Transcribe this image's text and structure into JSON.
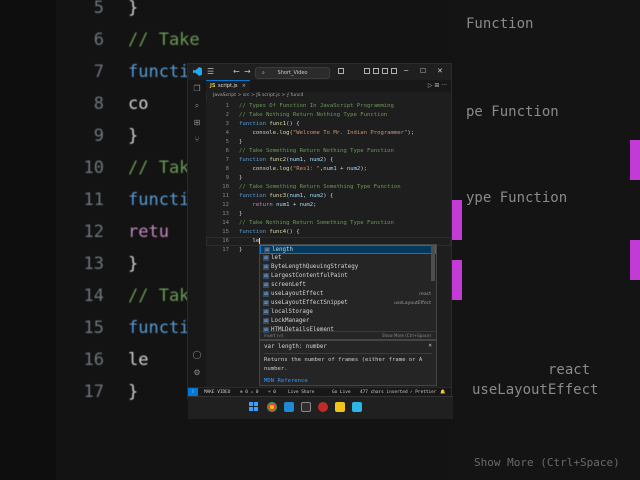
{
  "background": {
    "lines": [
      {
        "num": "5",
        "code": "}"
      },
      {
        "num": "6",
        "code": "// Take"
      },
      {
        "num": "7",
        "code": "functio"
      },
      {
        "num": "8",
        "code": "    co"
      },
      {
        "num": "9",
        "code": "}"
      },
      {
        "num": "10",
        "code": "// Take"
      },
      {
        "num": "11",
        "code": "functio"
      },
      {
        "num": "12",
        "code": "    retu"
      },
      {
        "num": "13",
        "code": "}"
      },
      {
        "num": "14",
        "code": "// Take"
      },
      {
        "num": "15",
        "code": "functio"
      },
      {
        "num": "16",
        "code": "    le"
      },
      {
        "num": "17",
        "code": "}"
      }
    ],
    "right_texts": [
      "Function",
      "pe Function",
      "ype Function",
      "react",
      "useLayoutEffect",
      "Show More (Ctrl+Space)"
    ]
  },
  "titlebar": {
    "search_text": "Short_Video",
    "nav_back": "←",
    "nav_forward": "→",
    "minimize": "─",
    "maximize": "☐",
    "close": "✕"
  },
  "tabs": [
    {
      "icon_text": "JS",
      "label": "script.js",
      "close": "×"
    }
  ],
  "tab_actions": "▷ ⊞ ···",
  "breadcrumb": "JavaScript > src > JS script.js > ⨍ func4",
  "editor": {
    "lines": [
      {
        "n": "1",
        "tokens": [
          {
            "c": "cm",
            "t": "// Types Of Function In JavaScript Programming"
          }
        ]
      },
      {
        "n": "2",
        "tokens": [
          {
            "c": "cm",
            "t": "// Take Nothing Return Nothing Type Function"
          }
        ]
      },
      {
        "n": "3",
        "tokens": [
          {
            "c": "kw",
            "t": "function "
          },
          {
            "c": "fn",
            "t": "func1"
          },
          {
            "c": "pl",
            "t": "() {"
          }
        ]
      },
      {
        "n": "4",
        "tokens": [
          {
            "c": "pl",
            "t": "    console."
          },
          {
            "c": "fn",
            "t": "log"
          },
          {
            "c": "pl",
            "t": "("
          },
          {
            "c": "st",
            "t": "\"Welcome To Mr. Indian Programmer\""
          },
          {
            "c": "pl",
            "t": ");"
          }
        ]
      },
      {
        "n": "5",
        "tokens": [
          {
            "c": "pl",
            "t": "}"
          }
        ]
      },
      {
        "n": "6",
        "tokens": [
          {
            "c": "cm",
            "t": "// Take Something Return Nothing Type Function"
          }
        ]
      },
      {
        "n": "7",
        "tokens": [
          {
            "c": "kw",
            "t": "function "
          },
          {
            "c": "fn",
            "t": "func2"
          },
          {
            "c": "pl",
            "t": "("
          },
          {
            "c": "pm",
            "t": "num1"
          },
          {
            "c": "pl",
            "t": ", "
          },
          {
            "c": "pm",
            "t": "num2"
          },
          {
            "c": "pl",
            "t": ") {"
          }
        ]
      },
      {
        "n": "8",
        "tokens": [
          {
            "c": "pl",
            "t": "    console."
          },
          {
            "c": "fn",
            "t": "log"
          },
          {
            "c": "pl",
            "t": "("
          },
          {
            "c": "st",
            "t": "\"Res1: \""
          },
          {
            "c": "pl",
            "t": ","
          },
          {
            "c": "pm",
            "t": "num1"
          },
          {
            "c": "pl",
            "t": " + "
          },
          {
            "c": "pm",
            "t": "num2"
          },
          {
            "c": "pl",
            "t": ");"
          }
        ]
      },
      {
        "n": "9",
        "tokens": [
          {
            "c": "pl",
            "t": "}"
          }
        ]
      },
      {
        "n": "10",
        "tokens": [
          {
            "c": "cm",
            "t": "// Take Something Return Something Type Function"
          }
        ]
      },
      {
        "n": "11",
        "tokens": [
          {
            "c": "kw",
            "t": "function "
          },
          {
            "c": "fn",
            "t": "func3"
          },
          {
            "c": "pl",
            "t": "("
          },
          {
            "c": "pm",
            "t": "num1"
          },
          {
            "c": "pl",
            "t": ", "
          },
          {
            "c": "pm",
            "t": "num2"
          },
          {
            "c": "pl",
            "t": ") {"
          }
        ]
      },
      {
        "n": "12",
        "tokens": [
          {
            "c": "pl",
            "t": "    "
          },
          {
            "c": "kc",
            "t": "return "
          },
          {
            "c": "pm",
            "t": "num1"
          },
          {
            "c": "pl",
            "t": " + "
          },
          {
            "c": "pm",
            "t": "num2"
          },
          {
            "c": "pl",
            "t": ";"
          }
        ]
      },
      {
        "n": "13",
        "tokens": [
          {
            "c": "pl",
            "t": "}"
          }
        ]
      },
      {
        "n": "14",
        "tokens": [
          {
            "c": "cm",
            "t": "// Take Nothing Return Something Type Function"
          }
        ]
      },
      {
        "n": "15",
        "tokens": [
          {
            "c": "kw",
            "t": "function "
          },
          {
            "c": "fn",
            "t": "func4"
          },
          {
            "c": "pl",
            "t": "() {"
          }
        ]
      },
      {
        "n": "16",
        "tokens": [
          {
            "c": "pl",
            "t": "    le"
          }
        ]
      },
      {
        "n": "17",
        "tokens": [
          {
            "c": "pl",
            "t": "}"
          }
        ]
      }
    ]
  },
  "suggest": {
    "items": [
      {
        "label": "length",
        "detail": "",
        "selected": true
      },
      {
        "label": "let",
        "detail": "",
        "selected": false
      },
      {
        "label": "ByteLengthQueuingStrategy",
        "detail": "",
        "selected": false
      },
      {
        "label": "LargestContentfulPaint",
        "detail": "",
        "selected": false
      },
      {
        "label": "screenLeft",
        "detail": "",
        "selected": false
      },
      {
        "label": "useLayoutEffect",
        "detail": "react",
        "selected": false
      },
      {
        "label": "useLayoutEffectSnippet",
        "detail": "useLayoutEffect",
        "selected": false
      },
      {
        "label": "localStorage",
        "detail": "",
        "selected": false
      },
      {
        "label": "LockManager",
        "detail": "",
        "selected": false
      },
      {
        "label": "HTMLDetailsElement",
        "detail": "",
        "selected": false
      }
    ],
    "footer_left": "insert (⏎)",
    "footer_right": "Show More (Ctrl+Space)"
  },
  "details": {
    "signature": "var length: number",
    "close": "×",
    "doc": "Returns the number of frames (either frame or A number.",
    "link": "MDN Reference"
  },
  "statusbar": {
    "remote": "⁞",
    "branch": "MAKE VIDEO",
    "errors": "⊗ 0 ⚠ 0",
    "ports": "⑂ 0",
    "live_share": "Live Share",
    "go_live": "Go Live",
    "chars": "477 chars inserted",
    "prettier": "✓ Prettier",
    "bell": "🔔"
  },
  "colors": {
    "accent": "#0078d4",
    "editor_bg": "#1e1e1e"
  }
}
